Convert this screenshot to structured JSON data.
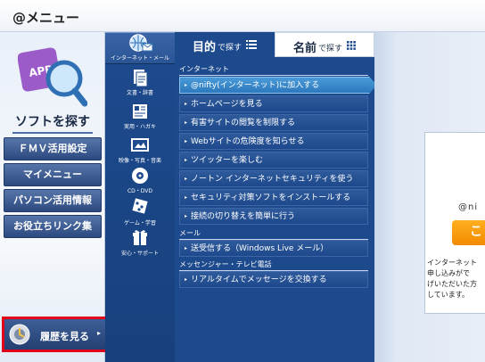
{
  "window": {
    "title": "@メニュー"
  },
  "left": {
    "soft_label": "ソフトを探す",
    "app_icon_text": "APP",
    "nav": [
      {
        "label": "ＦＭＶ活用設定"
      },
      {
        "label": "マイメニュー"
      },
      {
        "label": "パソコン活用情報"
      },
      {
        "label": "お役立ちリンク集"
      }
    ],
    "history_label": "履歴を見る",
    "history_arrow": "▸"
  },
  "categories": [
    {
      "label": "インターネット・メール",
      "icon": "internet-mail-icon"
    },
    {
      "label": "文書・辞書",
      "icon": "document-dictionary-icon"
    },
    {
      "label": "実用・ハガキ",
      "icon": "practical-postcard-icon"
    },
    {
      "label": "映像・写真・音楽",
      "icon": "video-photo-music-icon"
    },
    {
      "label": "CD・DVD",
      "icon": "cd-dvd-icon"
    },
    {
      "label": "ゲーム・学習",
      "icon": "game-learning-icon"
    },
    {
      "label": "安心・サポート",
      "icon": "safety-support-icon"
    }
  ],
  "tabs": {
    "purpose": {
      "big": "目的",
      "small": "で探す",
      "icon": "list-icon"
    },
    "name": {
      "big": "名前",
      "small": "で探す",
      "icon": "grid-icon"
    }
  },
  "menu": {
    "sections": [
      {
        "title": "インターネット"
      },
      {
        "title": "メール"
      },
      {
        "title": "メッセンジャー・テレビ電話"
      }
    ],
    "items": [
      {
        "label": "@nifty(インターネット)に加入する"
      },
      {
        "label": "ホームページを見る"
      },
      {
        "label": "有害サイトの閲覧を制限する"
      },
      {
        "label": "Webサイトの危険度を知らせる"
      },
      {
        "label": "ツイッターを楽しむ"
      },
      {
        "label": "ノートン インターネットセキュリティを使う"
      },
      {
        "label": "セキュリティ対策ソフトをインストールする"
      },
      {
        "label": "接続の切り替えを簡単に行う"
      },
      {
        "label": "送受信する（Windows Live メール）"
      },
      {
        "label": "リアルタイムでメッセージを交換する"
      }
    ],
    "arrow": "▸"
  },
  "right": {
    "nifty_text": "@ni",
    "button_text": "こ",
    "lines": [
      "インターネット",
      "申し込みがで",
      "げいただいた方",
      "しています。"
    ]
  },
  "colors": {
    "accent": "#1d4a8d",
    "highlight": "#e3001b",
    "orange": "#f28a00"
  }
}
